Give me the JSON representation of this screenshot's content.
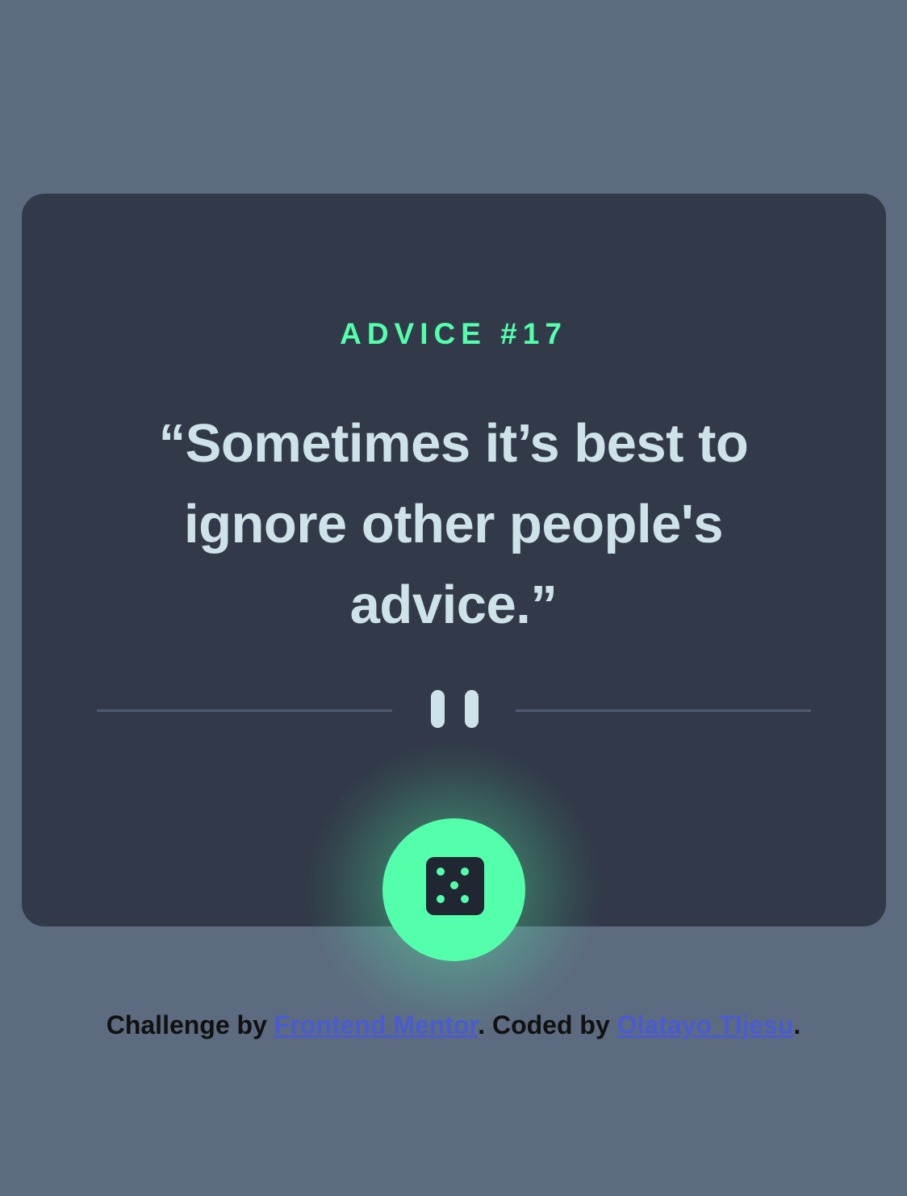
{
  "advice": {
    "label": "ADVICE #17",
    "quote": "“Sometimes it’s best to ignore other people's advice.”"
  },
  "actions": {
    "dice_icon": "dice-icon"
  },
  "footer": {
    "prefix": "Challenge by ",
    "challenge_link": "Frontend Mentor",
    "middle": ". Coded by ",
    "author_link": "Olatayo TIjesu",
    "suffix": "."
  },
  "colors": {
    "background": "#5c6b80",
    "card": "#323a49",
    "accent": "#53ffaa",
    "quote_text": "#cee3e9",
    "link": "#4a5bd0"
  }
}
